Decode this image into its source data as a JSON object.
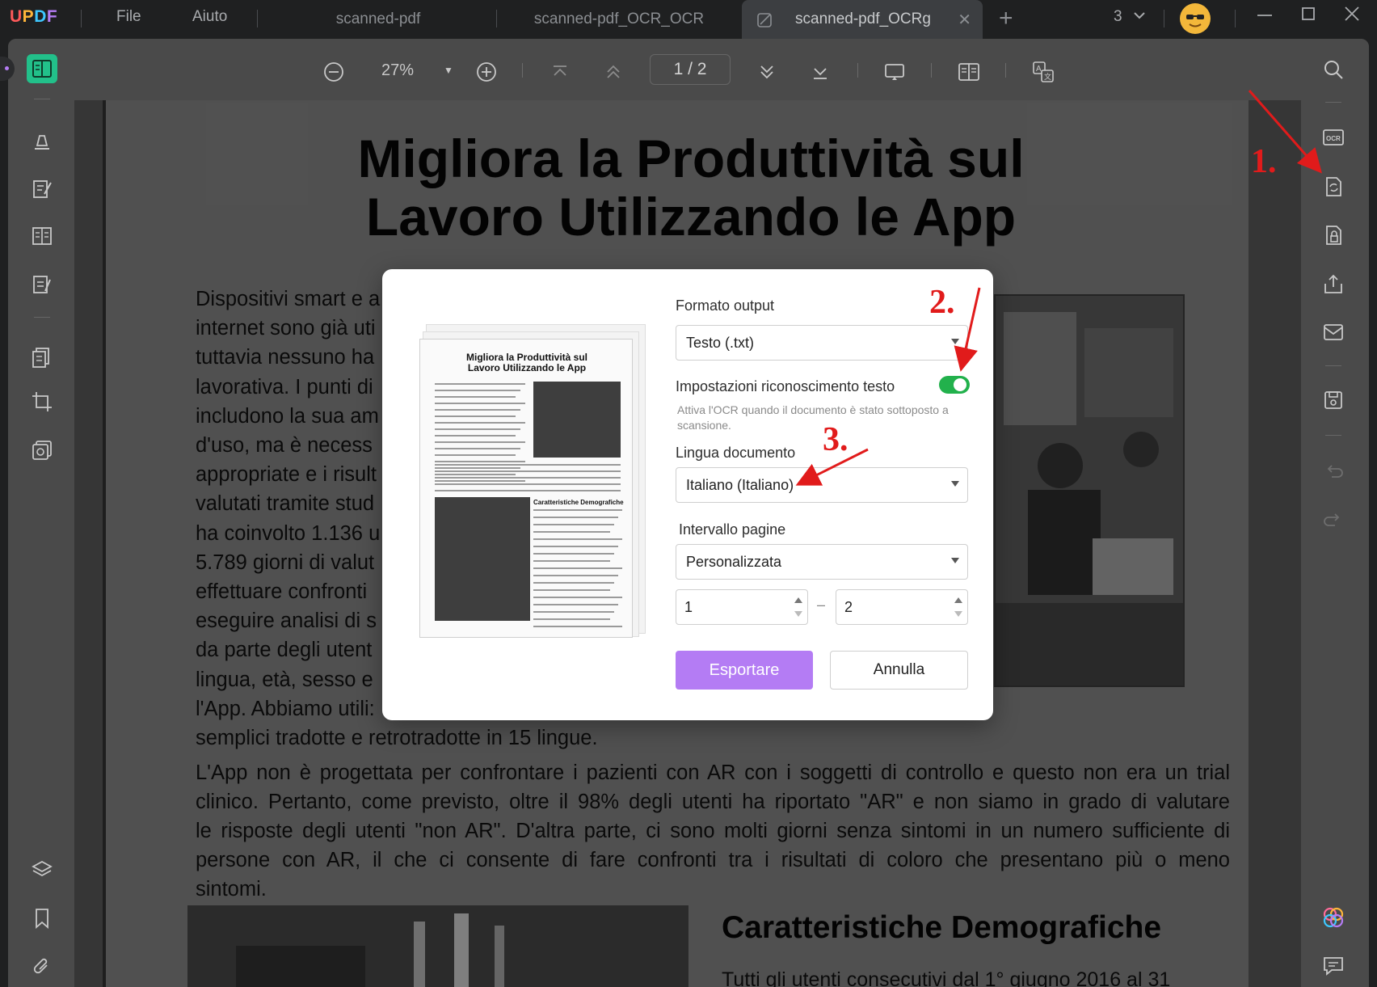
{
  "app": {
    "logo": "UPDF",
    "menu": [
      {
        "label": "File"
      },
      {
        "label": "Aiuto"
      }
    ],
    "tabs": [
      {
        "label": "scanned-pdf"
      },
      {
        "label": "scanned-pdf_OCR_OCR"
      },
      {
        "label": "scanned-pdf_OCRg"
      }
    ],
    "tab_count": "3"
  },
  "toolbar": {
    "zoom": "27%",
    "page_indicator": "1 / 2"
  },
  "document": {
    "title_line1": "Migliora la Produttività sul",
    "title_line2": "Lavoro Utilizzando le App",
    "left_lines": [
      "Dispositivi smart e a",
      "internet sono già uti",
      "tuttavia nessuno ha",
      "lavorativa. I punti di",
      "includono la sua am",
      "d'uso, ma è necess",
      "appropriate e i risult",
      "valutati tramite stud",
      "ha coinvolto 1.136 u",
      "5.789 giorni di valut",
      "effettuare confronti",
      "eseguire analisi di s",
      "da parte degli utent",
      "lingua, età, sesso e",
      "l'App. Abbiamo utili:",
      "semplici tradotte e retrotradotte in 15 lingue."
    ],
    "para_lines": [
      "L'App non è progettata per confrontare i pazienti con AR con i soggetti di controllo e questo non era un trial",
      "clinico. Pertanto, come previsto, oltre il 98% degli utenti ha riportato \"AR\" e non siamo in grado di valutare",
      "le risposte degli utenti \"non AR\". D'altra parte, ci sono molti giorni senza sintomi in un numero sufficiente di",
      "persone con AR, il che ci consente di fare confronti tra i risultati di coloro che presentano più o meno",
      "sintomi."
    ],
    "section_heading": "Caratteristiche Demografiche",
    "section_first_line": "Tutti gli utenti consecutivi dal 1° giugno 2016 al 31"
  },
  "dialog": {
    "thumb_title": "Migliora la Produttività sul Lavoro Utilizzando le App",
    "thumb_subheading": "Caratteristiche Demografiche",
    "output_format_label": "Formato output",
    "output_format_value": "Testo (.txt)",
    "ocr_label": "Impostazioni riconoscimento testo",
    "ocr_enabled": true,
    "ocr_hint": "Attiva l'OCR quando il documento è stato sottoposto a scansione.",
    "language_label": "Lingua documento",
    "language_value": "Italiano (Italiano)",
    "range_label": "Intervallo pagine",
    "range_value": "Personalizzata",
    "range_from": "1",
    "range_to": "2",
    "range_dash": "–",
    "export_button": "Esportare",
    "cancel_button": "Annulla"
  },
  "annotations": {
    "step1": "1.",
    "step2": "2.",
    "step3": "3."
  },
  "colors": {
    "accent_purple": "#b47cf4",
    "toggle_green": "#22b14c",
    "annotation_red": "#e11b1b"
  },
  "icons": {
    "toolbar": [
      "zoom-out-icon",
      "zoom-in-icon",
      "first-page-icon",
      "prev-page-icon",
      "next-page-icon",
      "last-page-icon",
      "presentation-icon",
      "two-page-icon",
      "translate-icon"
    ],
    "left_rail": [
      "reader-icon",
      "highlighter-icon",
      "edit-pdf-icon",
      "organize-icon",
      "form-icon",
      "page-tools-icon",
      "crop-icon",
      "stamp-icon",
      "layers-icon",
      "bookmark-icon",
      "attachment-icon"
    ],
    "right_rail": [
      "search-icon",
      "ocr-icon",
      "convert-icon",
      "protect-icon",
      "share-icon",
      "mail-icon",
      "save-icon",
      "undo-icon",
      "redo-icon",
      "ai-icon",
      "comment-icon"
    ]
  }
}
